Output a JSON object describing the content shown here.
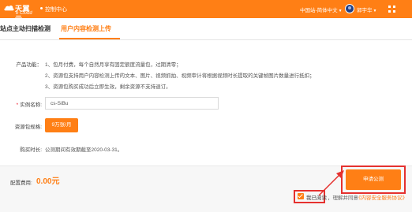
{
  "header": {
    "logo_cn": "天翼云",
    "logo_en": "e Cloud",
    "console": "控制中心",
    "site_selector": "中国站-简体中文",
    "username": "郭宇华"
  },
  "tabs": [
    {
      "label": "站点主动扫描检测"
    },
    {
      "label": "用户内容检测上传"
    }
  ],
  "form": {
    "features_label": "产品功能：",
    "features": [
      "1、包月付费，每个自然月享有固定额度流量包，过期清零；",
      "2、资源包支持用户内容检测上传的文本、图片、视频抓拍、视频审计将根据视频时长提取的关键帧图片数量进行抵扣；",
      "3、资源包购买成功后立即生效，剩余资源不支持退订。"
    ],
    "instance_label": "实例名称:",
    "instance_required": "*",
    "instance_value": "cs-SiBu",
    "spec_label": "资源包规格:",
    "spec_value": "9万张/月",
    "duration_label": "购买时长:",
    "duration_value": "公测期间有效期截至2020-03-31。"
  },
  "footer": {
    "fee_label": "配置费用:",
    "fee_value": "0.00元",
    "apply_label": "申请公测",
    "agree_read": "我已阅读",
    "agree_text": "，理解并同意",
    "agree_link": "《内容安全服务协议》"
  },
  "colors": {
    "accent": "#ff7f15",
    "highlight": "#e5312f"
  }
}
